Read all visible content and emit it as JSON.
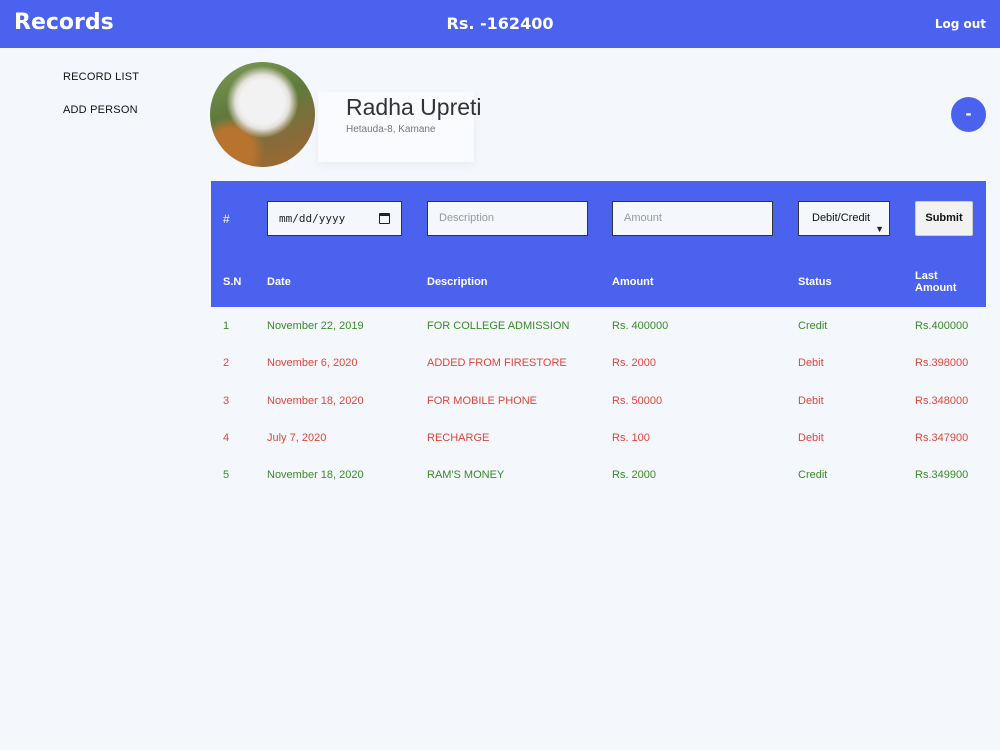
{
  "header": {
    "brand": "Records",
    "total": "Rs. -162400",
    "logout": "Log out"
  },
  "sidebar": {
    "items": [
      {
        "label": "RECORD LIST"
      },
      {
        "label": "ADD PERSON"
      }
    ]
  },
  "profile": {
    "name": "Radha Upreti",
    "address": "Hetauda-8, Kamane",
    "action_label": "-"
  },
  "form": {
    "hash": "#",
    "date_value": "mm/dd/yyyy",
    "description_placeholder": "Description",
    "amount_placeholder": "Amount",
    "type_select": "Debit/Credit",
    "submit_label": "Submit"
  },
  "table": {
    "columns": [
      "S.N",
      "Date",
      "Description",
      "Amount",
      "Status",
      "Last Amount"
    ],
    "rows": [
      {
        "sn": "1",
        "date": "November 22, 2019",
        "description": "FOR COLLEGE ADMISSION",
        "amount": "Rs. 400000",
        "status": "Credit",
        "last_amount": "Rs.400000"
      },
      {
        "sn": "2",
        "date": "November 6, 2020",
        "description": "ADDED FROM FIRESTORE",
        "amount": "Rs. 2000",
        "status": "Debit",
        "last_amount": "Rs.398000"
      },
      {
        "sn": "3",
        "date": "November 18, 2020",
        "description": "FOR MOBILE PHONE",
        "amount": "Rs. 50000",
        "status": "Debit",
        "last_amount": "Rs.348000"
      },
      {
        "sn": "4",
        "date": "July 7, 2020",
        "description": "RECHARGE",
        "amount": "Rs. 100",
        "status": "Debit",
        "last_amount": "Rs.347900"
      },
      {
        "sn": "5",
        "date": "November 18, 2020",
        "description": "RAM'S MONEY",
        "amount": "Rs. 2000",
        "status": "Credit",
        "last_amount": "Rs.349900"
      }
    ]
  },
  "colors": {
    "primary": "#4a62ed",
    "credit": "#3a8a27",
    "debit": "#e0463a",
    "background": "#f4f7fb"
  }
}
